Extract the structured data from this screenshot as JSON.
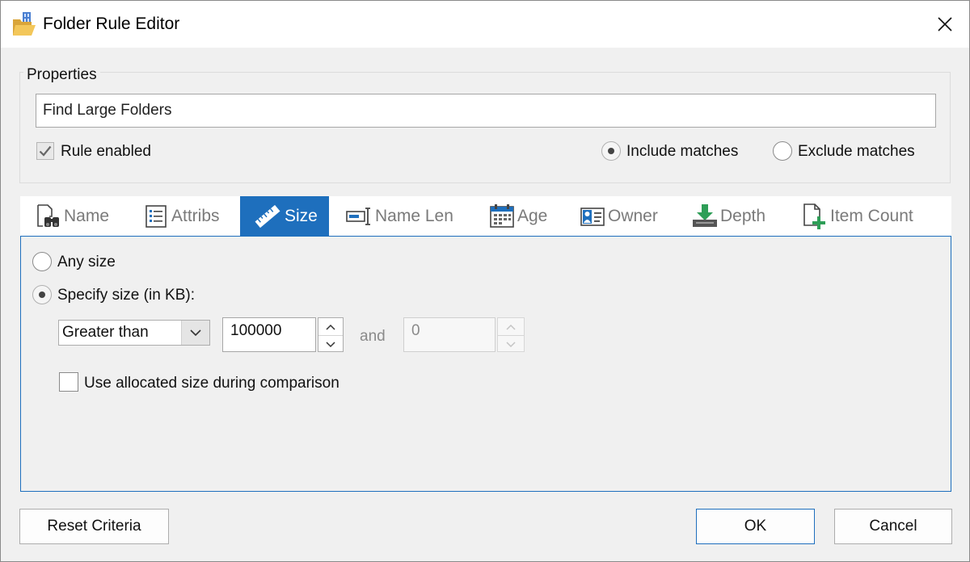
{
  "window": {
    "title": "Folder Rule Editor"
  },
  "properties": {
    "legend": "Properties",
    "rule_name": "Find Large Folders",
    "rule_enabled_label": "Rule enabled",
    "rule_enabled": true,
    "include_label": "Include matches",
    "exclude_label": "Exclude matches",
    "match_mode": "include"
  },
  "tabs": [
    {
      "label": "Name",
      "icon": "binoculars-icon"
    },
    {
      "label": "Attribs",
      "icon": "list-icon"
    },
    {
      "label": "Size",
      "icon": "ruler-icon",
      "active": true
    },
    {
      "label": "Name Len",
      "icon": "text-length-icon"
    },
    {
      "label": "Age",
      "icon": "calendar-icon"
    },
    {
      "label": "Owner",
      "icon": "user-card-icon"
    },
    {
      "label": "Depth",
      "icon": "download-depth-icon"
    },
    {
      "label": "Item Count",
      "icon": "document-plus-icon"
    }
  ],
  "size": {
    "any_size_label": "Any size",
    "specify_label": "Specify size (in KB):",
    "mode": "specify",
    "comparison": "Greater than",
    "value1": "100000",
    "and_label": "and",
    "value2": "0",
    "allocated_label": "Use allocated size during comparison",
    "allocated_checked": false
  },
  "buttons": {
    "reset": "Reset Criteria",
    "ok": "OK",
    "cancel": "Cancel"
  },
  "colors": {
    "accent": "#1e6fbd",
    "titlebar": "#ffffff",
    "background": "#f0f0f0"
  }
}
